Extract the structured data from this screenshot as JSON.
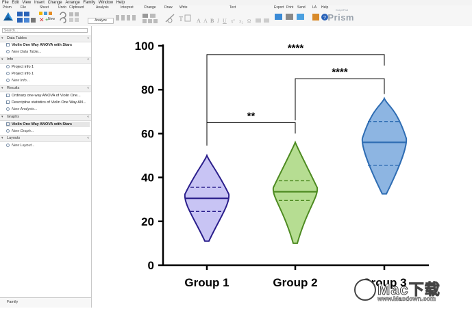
{
  "menubar": {
    "items": [
      "File",
      "Edit",
      "View",
      "Insert",
      "Change",
      "Arrange",
      "Family",
      "Window",
      "Help"
    ]
  },
  "ribbon": {
    "groups": [
      "Prism",
      "File",
      "Sheet",
      "Undo",
      "Clipboard",
      "Analysis",
      "Interpret",
      "Change",
      "Draw",
      "Write",
      "Text",
      "Export",
      "Print",
      "Send",
      "LA",
      "Help"
    ],
    "analyze_label": "Analyze",
    "new_label": "New",
    "brand_top": "GraphPad",
    "brand": "Prism"
  },
  "navigator": {
    "search_placeholder": "Search...",
    "sections": [
      {
        "label": "Data Tables",
        "items": [
          {
            "label": "Violin One Way ANOVA with Stars",
            "style": "bold"
          },
          {
            "label": "New Data Table...",
            "style": "italic"
          }
        ]
      },
      {
        "label": "Info",
        "items": [
          {
            "label": "Project info 1",
            "style": "normal"
          },
          {
            "label": "Project info 1",
            "style": "normal"
          },
          {
            "label": "New Info...",
            "style": "italic"
          }
        ]
      },
      {
        "label": "Results",
        "items": [
          {
            "label": "Ordinary one-way ANOVA of Violin One...",
            "style": "normal"
          },
          {
            "label": "Descriptive statistics of Violin One Way AN...",
            "style": "normal"
          },
          {
            "label": "New Analysis...",
            "style": "italic"
          }
        ]
      },
      {
        "label": "Graphs",
        "items": [
          {
            "label": "Violin One Way ANOVA with Stars",
            "style": "bold-selected"
          },
          {
            "label": "New Graph...",
            "style": "italic"
          }
        ]
      },
      {
        "label": "Layouts",
        "items": [
          {
            "label": "New Layout...",
            "style": "italic"
          }
        ]
      }
    ],
    "family_label": "Family"
  },
  "chart_data": {
    "type": "violin",
    "categories": [
      "Group 1",
      "Group 2",
      "Group 3"
    ],
    "series": [
      {
        "name": "Group 1",
        "min": 11,
        "q1": 24.5,
        "median": 30.5,
        "q3": 35.5,
        "max": 50,
        "color": "#c8c4f4",
        "stroke": "#2b1f8c"
      },
      {
        "name": "Group 2",
        "min": 10,
        "q1": 29.5,
        "median": 33.5,
        "q3": 38.5,
        "max": 56,
        "color": "#b6dd92",
        "stroke": "#4d8a21"
      },
      {
        "name": "Group 3",
        "min": 32.5,
        "q1": 45.5,
        "median": 56,
        "q3": 65.5,
        "max": 76,
        "color": "#8db5e2",
        "stroke": "#2f6db3"
      }
    ],
    "ylim": [
      0,
      100
    ],
    "yticks": [
      0,
      20,
      40,
      60,
      80,
      100
    ],
    "comparisons": [
      {
        "from": "Group 1",
        "to": "Group 2",
        "label": "**"
      },
      {
        "from": "Group 2",
        "to": "Group 3",
        "label": "****"
      },
      {
        "from": "Group 1",
        "to": "Group 3",
        "label": "****"
      }
    ],
    "grid": false
  },
  "watermark": {
    "big": "Mac下载",
    "small": "www.Macdown.com"
  }
}
